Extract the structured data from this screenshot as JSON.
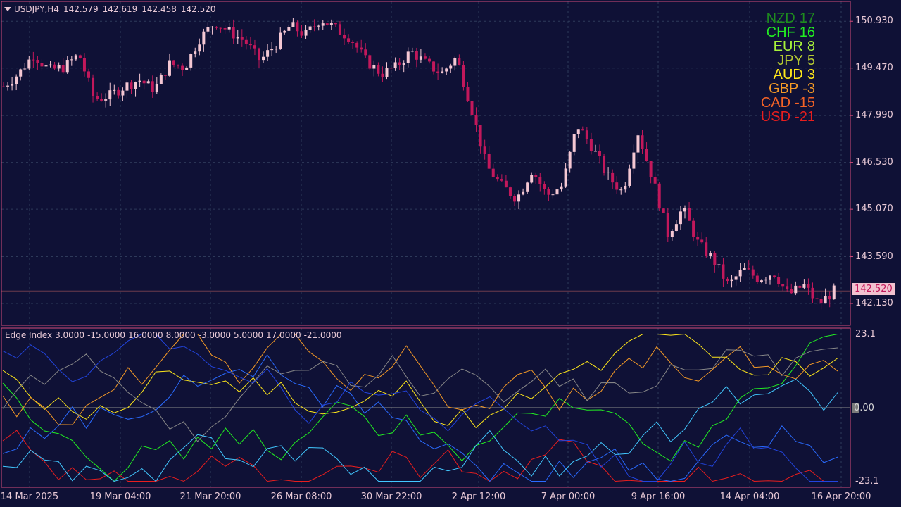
{
  "header": {
    "symbol": "USDJPY,H4",
    "open": "142.579",
    "high": "142.619",
    "low": "142.458",
    "close": "142.520"
  },
  "price_axis": [
    "150.930",
    "149.470",
    "147.990",
    "146.530",
    "145.070",
    "143.590",
    "142.130"
  ],
  "current_price": "142.520",
  "time_axis": [
    "14 Mar 2025",
    "19 Mar 04:00",
    "21 Mar 20:00",
    "26 Mar 08:00",
    "30 Mar 22:00",
    "2 Apr 12:00",
    "7 Apr 00:00",
    "9 Apr 16:00",
    "14 Apr 04:00",
    "16 Apr 20:00"
  ],
  "strength": [
    {
      "ccy": "NZD",
      "val": "17",
      "color": "#1e8c1e"
    },
    {
      "ccy": "CHF",
      "val": "16",
      "color": "#22ee22"
    },
    {
      "ccy": "EUR",
      "val": "8",
      "color": "#a8f23a"
    },
    {
      "ccy": "JPY",
      "val": "5",
      "color": "#b4c832"
    },
    {
      "ccy": "AUD",
      "val": "3",
      "color": "#ffe81a"
    },
    {
      "ccy": "GBP",
      "val": "-3",
      "color": "#f59a26"
    },
    {
      "ccy": "CAD",
      "val": "-15",
      "color": "#f56326"
    },
    {
      "ccy": "USD",
      "val": "-21",
      "color": "#e81e1e"
    }
  ],
  "indicator": {
    "name": "Edge Index",
    "values": [
      "3.0000",
      "-15.0000",
      "16.0000",
      "8.0000",
      "-3.0000",
      "5.0000",
      "17.0000",
      "-21.0000"
    ],
    "axis_top": "23.1",
    "axis_zero": "0.00",
    "axis_bottom": "-23.1"
  },
  "chart_data": {
    "type": "candlestick",
    "bull_color": "#f4c7d3",
    "bear_color": "#c2185b",
    "ylim": [
      141.45,
      151.55
    ],
    "anchor_closes": [
      148.9,
      149.3,
      149.9,
      149.4,
      149.5,
      149.9,
      148.5,
      148.6,
      148.9,
      149.1,
      148.8,
      149.6,
      149.5,
      150.4,
      150.9,
      150.6,
      150.3,
      149.7,
      150.2,
      150.8,
      150.5,
      151.0,
      150.7,
      150.4,
      149.7,
      149.3,
      149.5,
      150.0,
      149.6,
      149.3,
      149.8,
      148.2,
      146.4,
      145.8,
      145.4,
      146.3,
      145.5,
      145.8,
      147.7,
      147.0,
      146.1,
      145.6,
      147.5,
      146.0,
      144.3,
      145.1,
      144.0,
      143.5,
      142.7,
      143.2,
      142.9,
      143.1,
      142.4,
      142.7,
      142.1,
      142.52
    ],
    "indicator_lines": [
      {
        "ccy": "NZD",
        "color": "#ffe81a",
        "y": [
          10,
          17,
          17,
          8,
          5,
          0,
          12,
          14,
          3,
          17,
          20,
          23.1,
          23.1,
          22,
          20,
          17
        ],
        "x": [
          0,
          40,
          80,
          120,
          160,
          200,
          260,
          300,
          380,
          460,
          520,
          560,
          640,
          700,
          900,
          1188
        ]
      },
      {
        "ccy": "USD",
        "color": "#e81e1e",
        "y": [
          -5,
          -5,
          -22,
          -22,
          -20,
          -10,
          0,
          1,
          8,
          12,
          2,
          21,
          21,
          -5,
          -23,
          -23,
          -12,
          -12,
          -8,
          -8,
          -23.1,
          -23.1
        ],
        "x": [
          0,
          40,
          60,
          170,
          200,
          230,
          260,
          300,
          380,
          450,
          520,
          600,
          640,
          680,
          700,
          720,
          760,
          800,
          900,
          960,
          990,
          1188
        ]
      }
    ]
  }
}
